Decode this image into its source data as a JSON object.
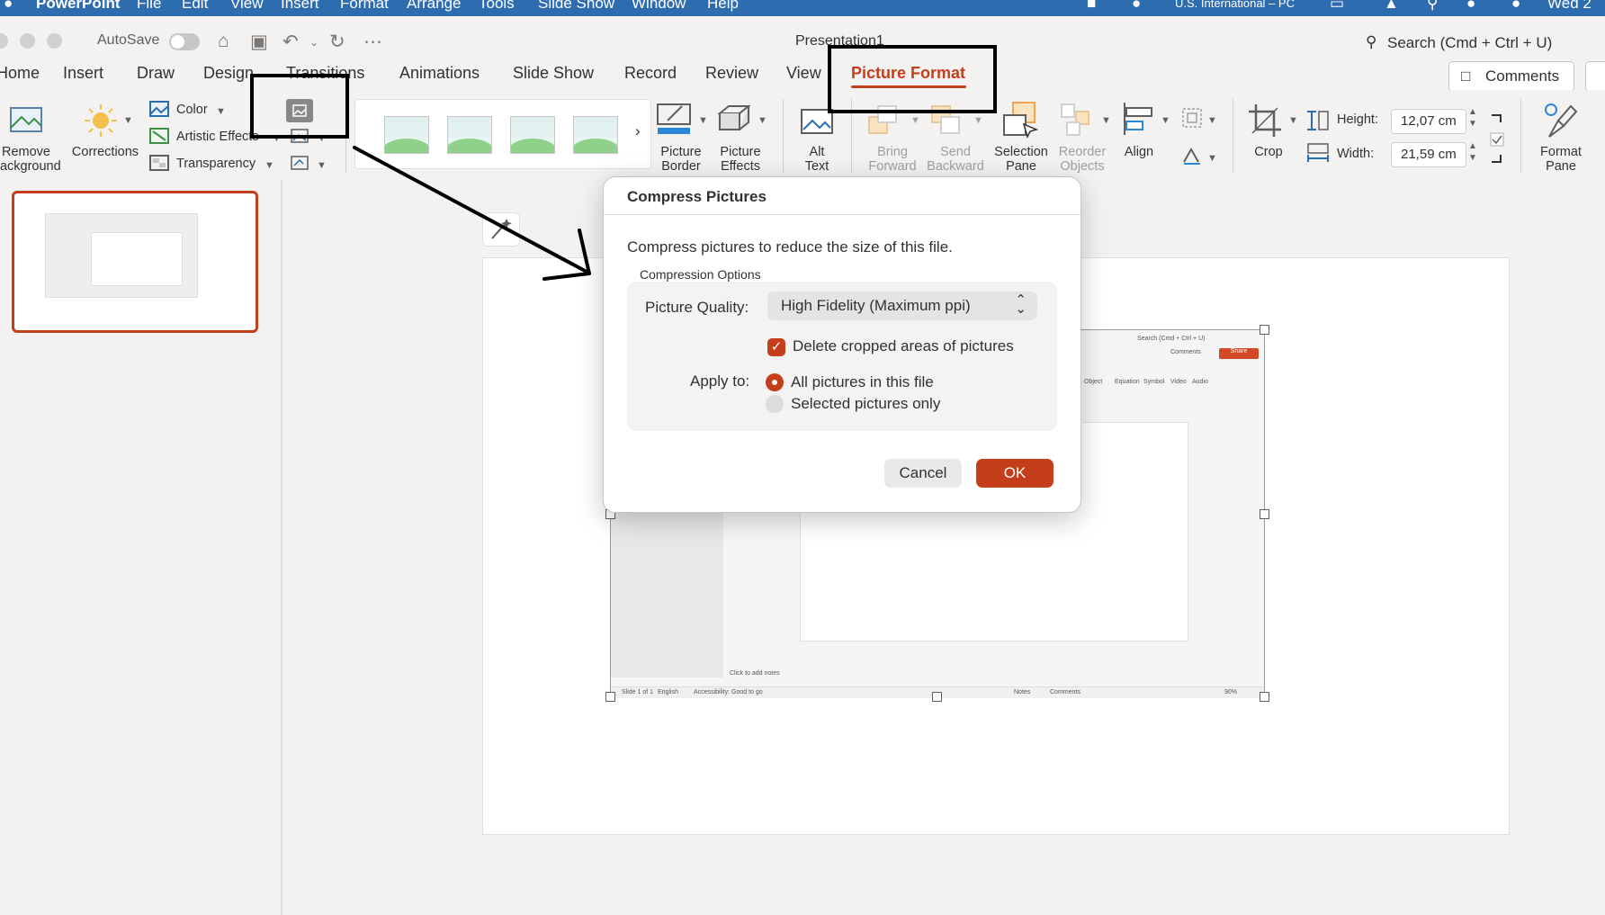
{
  "menubar": {
    "app": "PowerPoint",
    "items": [
      "File",
      "Edit",
      "View",
      "Insert",
      "Format",
      "Arrange",
      "Tools",
      "Slide Show",
      "Window",
      "Help"
    ],
    "keyboard": "U.S. International – PC",
    "clock": "Wed 2"
  },
  "titlebar": {
    "autosave": "AutoSave",
    "doc_title": "Presentation1",
    "search": "Search (Cmd + Ctrl + U)"
  },
  "tabs": [
    "Home",
    "Insert",
    "Draw",
    "Design",
    "Transitions",
    "Animations",
    "Slide Show",
    "Record",
    "Review",
    "View",
    "Picture Format"
  ],
  "active_tab": "Picture Format",
  "comments_label": "Comments",
  "ribbon": {
    "remove_background": [
      "Remove",
      "Background"
    ],
    "corrections": "Corrections",
    "color": "Color",
    "artistic_effects": "Artistic Effects",
    "transparency": "Transparency",
    "picture_border": [
      "Picture",
      "Border"
    ],
    "picture_effects": [
      "Picture",
      "Effects"
    ],
    "alt_text": [
      "Alt",
      "Text"
    ],
    "bring_forward": [
      "Bring",
      "Forward"
    ],
    "send_backward": [
      "Send",
      "Backward"
    ],
    "selection_pane": [
      "Selection",
      "Pane"
    ],
    "reorder_objects": [
      "Reorder",
      "Objects"
    ],
    "align": "Align",
    "crop": "Crop",
    "height_label": "Height:",
    "height_value": "12,07 cm",
    "width_label": "Width:",
    "width_value": "21,59 cm",
    "format_pane": [
      "Format",
      "Pane"
    ]
  },
  "embedded_screenshot": {
    "search": "Search (Cmd + Ctrl + U)",
    "comments": "Comments",
    "share": "Share",
    "object": "Object",
    "equation": "Equation",
    "symbol": "Symbol",
    "video": "Video",
    "audio": "Audio",
    "notes_placeholder": "Click to add notes",
    "slide_info": "Slide 1 of 1",
    "language": "English",
    "accessibility": "Accessibility: Good to go",
    "notes": "Notes",
    "status_comments": "Comments",
    "zoom": "90%"
  },
  "dialog": {
    "title": "Compress Pictures",
    "description": "Compress pictures to reduce the size of this file.",
    "group_label": "Compression Options",
    "quality_label": "Picture Quality:",
    "quality_value": "High Fidelity (Maximum ppi)",
    "delete_cropped": "Delete cropped areas of pictures",
    "delete_cropped_checked": true,
    "apply_to_label": "Apply to:",
    "apply_options": [
      "All pictures in this file",
      "Selected pictures only"
    ],
    "apply_selected": "All pictures in this file",
    "cancel": "Cancel",
    "ok": "OK"
  },
  "colors": {
    "accent": "#c43e1c",
    "menubar": "#2e6cb0",
    "background": "#f3f2f1"
  }
}
